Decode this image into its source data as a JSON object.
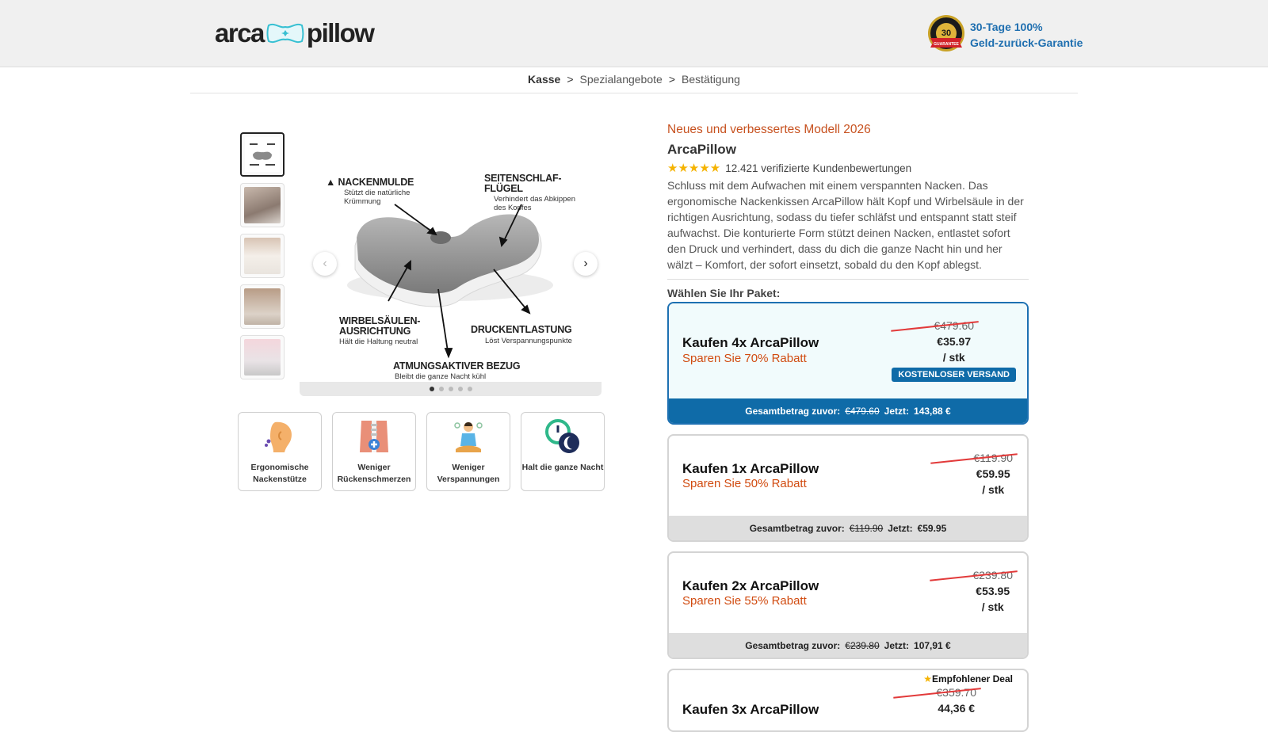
{
  "header": {
    "logo_left": "arca",
    "logo_right": "pillow",
    "guarantee_line1": "30-Tage 100%",
    "guarantee_line2": "Geld-zurück-Garantie",
    "seal_text_top": "MONEY BACK",
    "seal_number": "30",
    "seal_text_day": "DAY",
    "seal_text_bottom": "GUARANTEE"
  },
  "breadcrumb": {
    "step1": "Kasse",
    "sep": ">",
    "step2": "Spezialangebote",
    "step3": "Bestätigung"
  },
  "gallery": {
    "labels": {
      "nackenmulde": "NACKENMULDE",
      "nackenmulde_sub": "Stützt die natürliche Krümmung",
      "seiten": "SEITENSCHLAF-\nFLÜGEL",
      "seiten_sub": "Verhindert das Abkippen des Kopfes",
      "wirbel": "WIRBELSÄULEN-\nAUSRICHTUNG",
      "wirbel_sub": "Hält die Haltung neutral",
      "druck": "DRUCKENTLASTUNG",
      "druck_sub": "Löst Verspannungspunkte",
      "atmung": "ATMUNGSAKTIVER BEZUG",
      "atmung_sub": "Bleibt die ganze Nacht kühl"
    },
    "prev_arrow": "‹",
    "next_arrow": "›",
    "dots": 5,
    "active_dot": 0
  },
  "features": [
    {
      "label": "Ergonomische Nackenstütze"
    },
    {
      "label": "Weniger Rückenschmerzen"
    },
    {
      "label": "Weniger Verspannungen"
    },
    {
      "label": "Halt die ganze Nacht"
    }
  ],
  "product": {
    "new_model": "Neues und verbessertes Modell 2026",
    "name": "ArcaPillow",
    "rating": 4.5,
    "stars": "★★★★★",
    "reviews": "12.421 verifizierte Kundenbewertungen",
    "description": "Schluss mit dem Aufwachen mit einem verspannten Nacken. Das ergonomische Nackenkissen ArcaPillow hält Kopf und Wirbelsäule in der richtigen Ausrichtung, sodass du tiefer schläfst und entspannt statt steif aufwachst. Die konturierte Form stützt deinen Nacken, entlastet sofort den Druck und verhindert, dass du dich die ganze Nacht hin und her wälzt – Komfort, der sofort einsetzt, sobald du den Kopf ablegst.",
    "choose_label": "Wählen Sie Ihr Paket:"
  },
  "packages": [
    {
      "title": "Kaufen 4x ArcaPillow",
      "save": "Sparen Sie 70% Rabatt",
      "old_price": "€479.60",
      "new_price": "€35.97",
      "unit": "/ stk",
      "shipping": "KOSTENLOSER VERSAND",
      "footer_prefix": "Gesamtbetrag zuvor:",
      "footer_old": "€479.60",
      "footer_now_label": "Jetzt:",
      "footer_now": "143,88 €",
      "selected": true
    },
    {
      "title": "Kaufen 1x ArcaPillow",
      "save": "Sparen Sie 50% Rabatt",
      "old_price": "€119.90",
      "new_price": "€59.95",
      "unit": "/ stk",
      "footer_prefix": "Gesamtbetrag zuvor:",
      "footer_old": "€119.90",
      "footer_now_label": "Jetzt:",
      "footer_now": "€59.95"
    },
    {
      "title": "Kaufen 2x ArcaPillow",
      "save": "Sparen Sie 55% Rabatt",
      "old_price": "€239.80",
      "new_price": "€53.95",
      "unit": "/ stk",
      "footer_prefix": "Gesamtbetrag zuvor:",
      "footer_old": "€239.80",
      "footer_now_label": "Jetzt:",
      "footer_now": "107,91 €"
    },
    {
      "title": "Kaufen 3x ArcaPillow",
      "badge": "Empfohlener Deal",
      "old_price": "€359.70",
      "new_price": "44,36 €"
    }
  ],
  "colors": {
    "accent_blue": "#0f6ba8",
    "save_orange": "#d14b10",
    "star_yellow": "#f5b301"
  }
}
